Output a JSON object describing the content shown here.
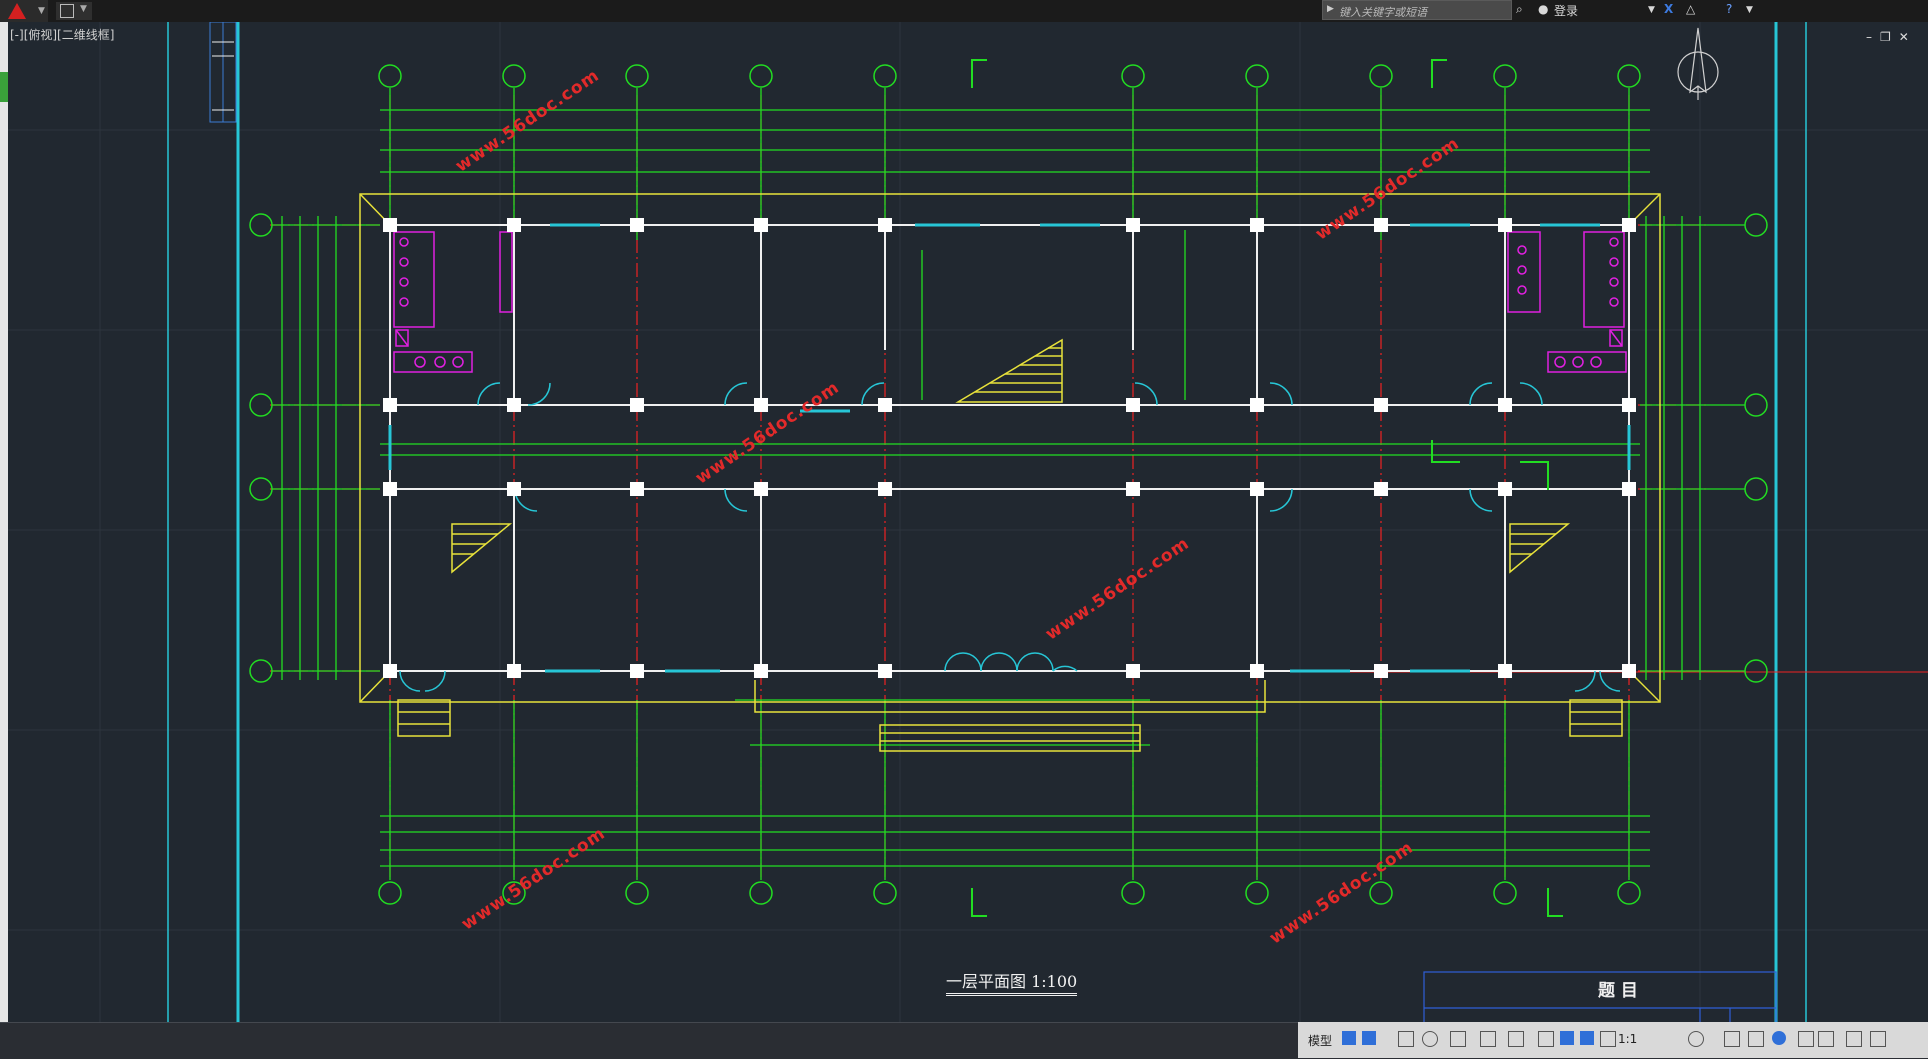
{
  "titlebar": {
    "search_placeholder": "键入关键字或短语",
    "login_label": "登录"
  },
  "viewport": {
    "label": "[-][俯视][二维线框]"
  },
  "drawing": {
    "title": "一层平面图 1:100",
    "title_block_heading": "题 目",
    "watermark": "www.56doc.com",
    "colors": {
      "background": "#212830",
      "grid_green": "#22dd22",
      "axis_red": "#ee2222",
      "wall_yellow": "#e8e23a",
      "wall_white": "#f0f0f0",
      "magenta": "#e020e0",
      "cyan": "#27c6d6",
      "watermark_red": "#e22a2a"
    }
  },
  "statusbar": {
    "model_label": "模型",
    "scale_label": "1:1"
  }
}
